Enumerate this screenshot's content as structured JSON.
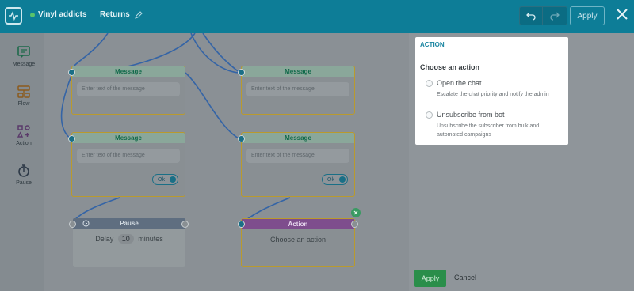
{
  "topbar": {
    "bot_name": "Vinyl addicts",
    "flow_name": "Returns",
    "apply_label": "Apply",
    "icons": [
      "pulse-logo-icon",
      "online-dot-icon",
      "pencil-icon",
      "undo-icon",
      "redo-icon",
      "close-icon"
    ]
  },
  "sidebar": {
    "items": [
      {
        "label": "Message",
        "icon": "message-icon"
      },
      {
        "label": "Flow",
        "icon": "flow-icon"
      },
      {
        "label": "Action",
        "icon": "action-icon"
      },
      {
        "label": "Pause",
        "icon": "stopwatch-icon"
      }
    ]
  },
  "canvas": {
    "message_nodes": [
      {
        "title": "Message",
        "placeholder": "Enter text of the message"
      },
      {
        "title": "Message",
        "placeholder": "Enter text of the message"
      },
      {
        "title": "Message",
        "placeholder": "Enter text of the message",
        "button": "Ok"
      },
      {
        "title": "Message",
        "placeholder": "Enter text of the message",
        "button": "Ok"
      }
    ],
    "pause_node": {
      "title": "Pause",
      "prefix": "Delay",
      "value": "10",
      "unit": "minutes"
    },
    "action_node": {
      "title": "Action",
      "text": "Choose an action"
    }
  },
  "panel": {
    "section_title": "ACTION",
    "heading": "Choose an action",
    "options": [
      {
        "label": "Open the chat",
        "description": "Escalate the chat priority and notify the admin"
      },
      {
        "label": "Unsubscribe from bot",
        "description": "Unsubscribe the subscriber from bulk and automated campaigns"
      }
    ],
    "apply_label": "Apply",
    "cancel_label": "Cancel"
  },
  "colors": {
    "topbar": "#0d7d97",
    "accent": "#1a85a1",
    "apply_green": "#2a8e4a",
    "node_border": "#b99a2e",
    "action_header": "#7e4d8d",
    "pause_header": "#5f6e80"
  }
}
